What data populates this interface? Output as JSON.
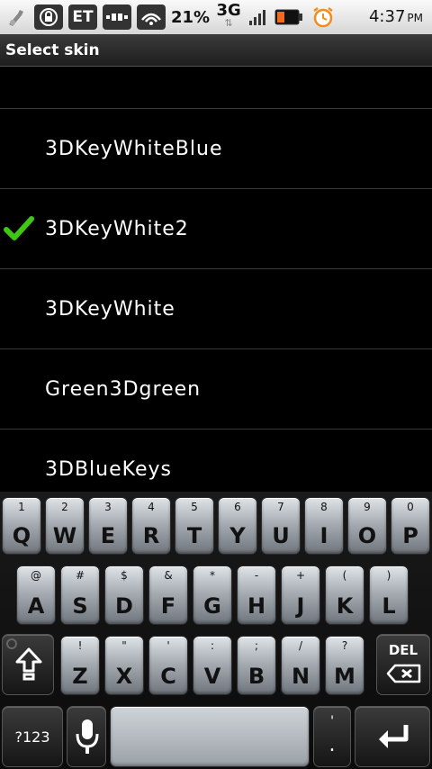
{
  "status_bar": {
    "badge_et": "ET",
    "battery_percent": "21%",
    "network": "3G",
    "time": "4:37",
    "ampm": "PM"
  },
  "dialog": {
    "title": "Select skin"
  },
  "skins": {
    "items": [
      {
        "label": "",
        "selected": false
      },
      {
        "label": "3DKeyWhiteBlue",
        "selected": false
      },
      {
        "label": "3DKeyWhite2",
        "selected": true
      },
      {
        "label": "3DKeyWhite",
        "selected": false
      },
      {
        "label": "Green3Dgreen",
        "selected": false
      },
      {
        "label": "3DBlueKeys",
        "selected": false
      }
    ]
  },
  "keyboard": {
    "row1": [
      {
        "main": "Q",
        "sub": "1"
      },
      {
        "main": "W",
        "sub": "2"
      },
      {
        "main": "E",
        "sub": "3"
      },
      {
        "main": "R",
        "sub": "4"
      },
      {
        "main": "T",
        "sub": "5"
      },
      {
        "main": "Y",
        "sub": "6"
      },
      {
        "main": "U",
        "sub": "7"
      },
      {
        "main": "I",
        "sub": "8"
      },
      {
        "main": "O",
        "sub": "9"
      },
      {
        "main": "P",
        "sub": "0"
      }
    ],
    "row2": [
      {
        "main": "A",
        "sub": "@"
      },
      {
        "main": "S",
        "sub": "#"
      },
      {
        "main": "D",
        "sub": "$"
      },
      {
        "main": "F",
        "sub": "&"
      },
      {
        "main": "G",
        "sub": "*"
      },
      {
        "main": "H",
        "sub": "-"
      },
      {
        "main": "J",
        "sub": "+"
      },
      {
        "main": "K",
        "sub": "("
      },
      {
        "main": "L",
        "sub": ")"
      }
    ],
    "row3": [
      {
        "main": "Z",
        "sub": "!"
      },
      {
        "main": "X",
        "sub": "\""
      },
      {
        "main": "C",
        "sub": "'"
      },
      {
        "main": "V",
        "sub": ":"
      },
      {
        "main": "B",
        "sub": ";"
      },
      {
        "main": "N",
        "sub": "/"
      },
      {
        "main": "M",
        "sub": "?"
      }
    ],
    "del_label": "DEL",
    "symbols_label": "?123",
    "punct_top": "'",
    "punct_main": "."
  }
}
